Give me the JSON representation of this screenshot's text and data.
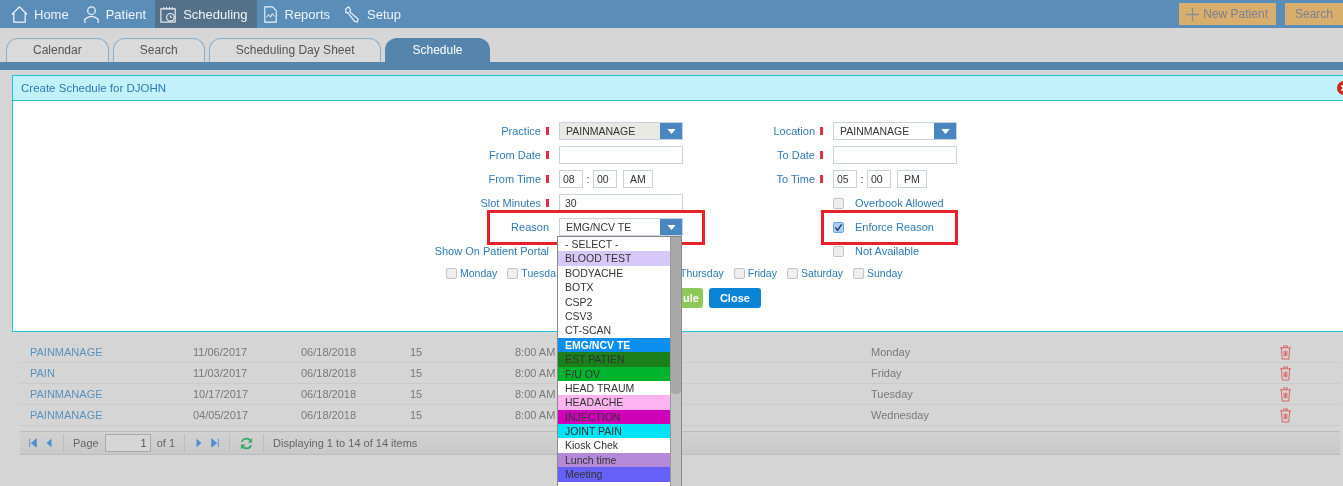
{
  "nav": {
    "items": [
      {
        "label": "Home",
        "selected": false
      },
      {
        "label": "Patient",
        "selected": false
      },
      {
        "label": "Scheduling",
        "selected": true
      },
      {
        "label": "Reports",
        "selected": false
      },
      {
        "label": "Setup",
        "selected": false
      }
    ],
    "actions": [
      {
        "label": "New Patient",
        "kind": "add"
      },
      {
        "label": "Search",
        "kind": "plain"
      }
    ]
  },
  "tabs": [
    {
      "label": "Calendar",
      "selected": false
    },
    {
      "label": "Search",
      "selected": false
    },
    {
      "label": "Scheduling Day Sheet",
      "selected": false
    },
    {
      "label": "Schedule",
      "selected": true
    }
  ],
  "dialog": {
    "title": "Create Schedule for DJOHN",
    "left_fields": [
      {
        "kind": "select",
        "label": "Practice",
        "required": true,
        "value": "PAINMANAGE",
        "disabled": true
      },
      {
        "kind": "text",
        "label": "From Date",
        "required": true
      },
      {
        "kind": "time",
        "label": "From Time",
        "required": true,
        "hour": "08",
        "separator": ":",
        "minute": "00",
        "period": "AM"
      },
      {
        "kind": "text",
        "label": "Slot Minutes",
        "required": true,
        "value": "30"
      },
      {
        "kind": "select",
        "label": "Reason",
        "required": false,
        "value": "EMG/NCV TE",
        "disabled": false,
        "highlighted": true
      },
      {
        "kind": "label",
        "label": "Show On Patient Portal"
      }
    ],
    "right_fields": [
      {
        "kind": "select",
        "label": "Location",
        "required": true,
        "value": "PAINMANAGE",
        "disabled": false
      },
      {
        "kind": "text",
        "label": "To Date",
        "required": true
      },
      {
        "kind": "time",
        "label": "To Time",
        "required": true,
        "hour": "05",
        "separator": ":",
        "minute": "00",
        "period": "PM"
      },
      {
        "kind": "checkbox",
        "label": "Overbook Allowed",
        "checked": false
      },
      {
        "kind": "checkbox",
        "label": "Enforce Reason",
        "checked": true,
        "highlighted": true
      },
      {
        "kind": "checkbox",
        "label": "Not Available",
        "checked": false
      }
    ],
    "weekdays_left": [
      {
        "label": "Monday",
        "checked": false
      },
      {
        "label": "Tuesda",
        "checked": false
      }
    ],
    "weekdays_right": [
      {
        "label": "Thursday"
      },
      {
        "label": "Friday",
        "checked": false
      },
      {
        "label": "Saturday",
        "checked": false
      },
      {
        "label": "Sunday",
        "checked": false
      }
    ],
    "buttons": [
      {
        "label": "ule",
        "kind": "save"
      },
      {
        "label": "Close",
        "kind": "close"
      }
    ],
    "reason_options": [
      {
        "label": "- SELECT -",
        "color": "#ffffff",
        "selected": false
      },
      {
        "label": "BLOOD TEST",
        "color": "#d6c9f9",
        "selected": false
      },
      {
        "label": "BODYACHE",
        "color": "#ffffff",
        "selected": false
      },
      {
        "label": "BOTX",
        "color": "#ffffff",
        "selected": false
      },
      {
        "label": "CSP2",
        "color": "#ffffff",
        "selected": false
      },
      {
        "label": "CSV3",
        "color": "#ffffff",
        "selected": false
      },
      {
        "label": "CT-SCAN",
        "color": "#ffffff",
        "selected": false
      },
      {
        "label": "EMG/NCV TE",
        "color": "#0a8ef0",
        "selected": true
      },
      {
        "label": "EST PATIEN",
        "color": "#1b7f1b",
        "selected": false
      },
      {
        "label": "F/U OV",
        "color": "#00b32c",
        "selected": false
      },
      {
        "label": "HEAD TRAUM",
        "color": "#ffffff",
        "selected": false
      },
      {
        "label": "HEADACHE",
        "color": "#fbb4f0",
        "selected": false
      },
      {
        "label": "INJECTION",
        "color": "#d000b8",
        "selected": false
      },
      {
        "label": "JOINT PAIN",
        "color": "#00e4f8",
        "selected": false
      },
      {
        "label": "Kiosk Chek",
        "color": "#ffffff",
        "selected": false
      },
      {
        "label": "Lunch time",
        "color": "#b48ad8",
        "selected": false
      },
      {
        "label": "Meeting",
        "color": "#6460f8",
        "selected": false
      }
    ]
  },
  "grid": {
    "rows": [
      {
        "practice": "PAINMANAGE",
        "from": "11/06/2017",
        "to": "06/18/2018",
        "slot": "15",
        "time": "8:00 AM",
        "days": "Monday"
      },
      {
        "practice": "PAIN",
        "from": "11/03/2017",
        "to": "06/18/2018",
        "slot": "15",
        "time": "8:00 AM",
        "days": "Friday"
      },
      {
        "practice": "PAINMANAGE",
        "from": "10/17/2017",
        "to": "06/18/2018",
        "slot": "15",
        "time": "8:00 AM",
        "days": "Tuesday"
      },
      {
        "practice": "PAINMANAGE",
        "from": "04/05/2017",
        "to": "06/18/2018",
        "slot": "15",
        "time": "8:00 AM",
        "days": "Wednesday"
      }
    ]
  },
  "pager": {
    "page_label": "Page",
    "page": "1",
    "of": "of 1",
    "summary": "Displaying 1 to 14 of 14 items"
  }
}
